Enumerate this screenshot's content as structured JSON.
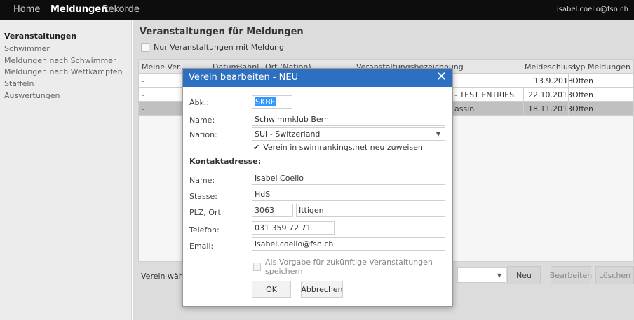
{
  "topnav": {
    "home": "Home",
    "meldungen": "Meldungen",
    "rekorde": "Rekorde",
    "user": "isabel.coello@fsn.ch"
  },
  "sidebar": {
    "items": [
      {
        "label": "Veranstaltungen",
        "active": true
      },
      {
        "label": "Schwimmer"
      },
      {
        "label": "Meldungen nach Schwimmer"
      },
      {
        "label": "Meldungen nach Wettkämpfen"
      },
      {
        "label": "Staffeln"
      },
      {
        "label": "Auswertungen"
      }
    ]
  },
  "main": {
    "title": "Veranstaltungen für Meldungen",
    "filter_label": "Nur Veranstaltungen mit Meldung",
    "table": {
      "headers": [
        "Meine Ver.",
        "Datum",
        "Bahnl.",
        "Ort (Nation)",
        "Veranstaltungsbezeichnung",
        "Meldeschluss",
        "Typ Meldungen"
      ],
      "rows": [
        {
          "meine": "-",
          "bezeichnung": "",
          "meldeschluss": "13.9.2013",
          "typ": "Offen"
        },
        {
          "meine": "-",
          "bezeichnung": "- TEST ENTRIES",
          "meldeschluss": "22.10.2013",
          "typ": "Offen"
        },
        {
          "meine": "-",
          "bezeichnung": "assin",
          "meldeschluss": "18.11.2013",
          "typ": "Offen"
        }
      ]
    },
    "bottom": {
      "label": "Verein wähle",
      "neu": "Neu",
      "bearbeiten": "Bearbeiten",
      "loeschen": "Löschen"
    }
  },
  "modal": {
    "title": "Verein bearbeiten - NEU",
    "close_icon": "close-icon",
    "abk_label": "Abk.:",
    "abk_value": "SKBE",
    "name_label": "Name:",
    "name_value": "Schwimmklub Bern",
    "nation_label": "Nation:",
    "nation_value": "SUI - Switzerland",
    "reassign_label": "Verein in swimrankings.net neu zuweisen",
    "contact_section": "Kontaktadresse:",
    "contact_name_label": "Name:",
    "contact_name_value": "Isabel Coello",
    "stasse_label": "Stasse:",
    "stasse_value": "HdS",
    "plz_label": "PLZ, Ort:",
    "plz_value": "3063",
    "ort_value": "Ittigen",
    "telefon_label": "Telefon:",
    "telefon_value": "031 359 72 71",
    "email_label": "Email:",
    "email_value": "isabel.coello@fsn.ch",
    "vorgabe_label": "Als Vorgabe für zukünftige Veranstaltungen speichern",
    "ok": "OK",
    "abbrechen": "Abbrechen"
  },
  "colors": {
    "modal_header": "#2d6fc1",
    "topnav_bg": "#0d0d0d",
    "selection": "#3399ff"
  }
}
